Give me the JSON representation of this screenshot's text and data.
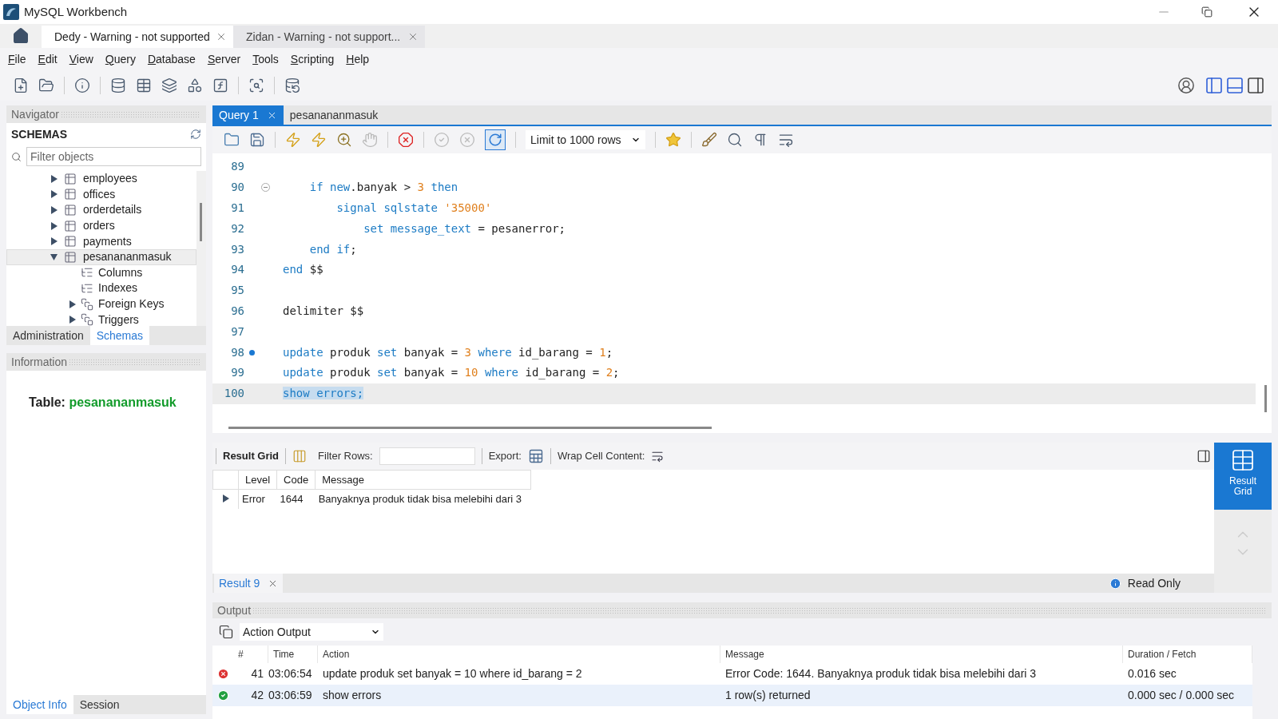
{
  "window": {
    "title": "MySQL Workbench"
  },
  "connection_tabs": [
    {
      "label": "Dedy - Warning - not supported",
      "selected": true
    },
    {
      "label": "Zidan - Warning - not support...",
      "selected": false
    }
  ],
  "menu": [
    "File",
    "Edit",
    "View",
    "Query",
    "Database",
    "Server",
    "Tools",
    "Scripting",
    "Help"
  ],
  "navigator": {
    "title": "Navigator",
    "section": "SCHEMAS",
    "filter": {
      "placeholder": "Filter objects"
    },
    "tree": [
      {
        "label": "employees",
        "expanded": false,
        "selected": false
      },
      {
        "label": "offices",
        "expanded": false,
        "selected": false
      },
      {
        "label": "orderdetails",
        "expanded": false,
        "selected": false
      },
      {
        "label": "orders",
        "expanded": false,
        "selected": false
      },
      {
        "label": "payments",
        "expanded": false,
        "selected": false
      },
      {
        "label": "pesanananmasuk",
        "expanded": true,
        "selected": true,
        "children": [
          {
            "label": "Columns",
            "kind": "leaf"
          },
          {
            "label": "Indexes",
            "kind": "leaf"
          },
          {
            "label": "Foreign Keys",
            "kind": "group",
            "expanded": false
          },
          {
            "label": "Triggers",
            "kind": "group",
            "expanded": false
          }
        ]
      }
    ],
    "tabs": [
      {
        "label": "Administration",
        "selected": false
      },
      {
        "label": "Schemas",
        "selected": true
      }
    ]
  },
  "information": {
    "title": "Information",
    "label": "Table:",
    "value": "pesanananmasuk",
    "tabs": [
      {
        "label": "Object Info",
        "selected": true
      },
      {
        "label": "Session",
        "selected": false
      }
    ]
  },
  "query_tabs": [
    {
      "label": "Query 1",
      "selected": true
    },
    {
      "label": "pesanananmasuk",
      "selected": false
    }
  ],
  "limit": "Limit to 1000 rows",
  "editor": {
    "lines": [
      {
        "number": "89",
        "selected": false,
        "marker": false
      },
      {
        "number": "90",
        "selected": false,
        "marker": false,
        "expanded": true,
        "tokens": [
          {
            "text": "    if",
            "kind": "keyword"
          },
          {
            "text": " new",
            "kind": "keyword"
          },
          {
            "text": ".banyak > ",
            "kind": "plain"
          },
          {
            "text": "3",
            "kind": "number"
          },
          {
            "text": " then",
            "kind": "keyword"
          }
        ]
      },
      {
        "number": "91",
        "selected": false,
        "marker": false,
        "tokens": [
          {
            "text": "        signal sqlstate",
            "kind": "keyword"
          },
          {
            "text": " '35000'",
            "kind": "string"
          }
        ]
      },
      {
        "number": "92",
        "selected": false,
        "marker": false,
        "tokens": [
          {
            "text": "            set message_text",
            "kind": "keyword"
          },
          {
            "text": " = pesanerror;",
            "kind": "plain"
          }
        ]
      },
      {
        "number": "93",
        "selected": false,
        "marker": false,
        "tokens": [
          {
            "text": "    end if",
            "kind": "keyword"
          },
          {
            "text": ";",
            "kind": "plain"
          }
        ]
      },
      {
        "number": "94",
        "selected": false,
        "marker": false,
        "tokens": [
          {
            "text": "end",
            "kind": "keyword"
          },
          {
            "text": " $$",
            "kind": "plain"
          }
        ]
      },
      {
        "number": "95",
        "selected": false,
        "marker": false
      },
      {
        "number": "96",
        "selected": false,
        "marker": false,
        "tokens": [
          {
            "text": "delimiter $$",
            "kind": "plain"
          }
        ]
      },
      {
        "number": "97",
        "selected": false,
        "marker": false
      },
      {
        "number": "98",
        "selected": false,
        "marker": true,
        "tokens": [
          {
            "text": "update",
            "kind": "keyword"
          },
          {
            "text": " produk ",
            "kind": "plain"
          },
          {
            "text": "set",
            "kind": "keyword"
          },
          {
            "text": " banyak = ",
            "kind": "plain"
          },
          {
            "text": "3",
            "kind": "number"
          },
          {
            "text": " where",
            "kind": "keyword"
          },
          {
            "text": " id_barang = ",
            "kind": "plain"
          },
          {
            "text": "1",
            "kind": "number"
          },
          {
            "text": ";",
            "kind": "plain"
          }
        ]
      },
      {
        "number": "99",
        "selected": false,
        "marker": false,
        "tokens": [
          {
            "text": "update",
            "kind": "keyword"
          },
          {
            "text": " produk ",
            "kind": "plain"
          },
          {
            "text": "set",
            "kind": "keyword"
          },
          {
            "text": " banyak = ",
            "kind": "plain"
          },
          {
            "text": "10",
            "kind": "number"
          },
          {
            "text": " where",
            "kind": "keyword"
          },
          {
            "text": " id_barang = ",
            "kind": "plain"
          },
          {
            "text": "2",
            "kind": "number"
          },
          {
            "text": ";",
            "kind": "plain"
          }
        ]
      },
      {
        "number": "100",
        "selected": true,
        "marker": false,
        "tokens": [
          {
            "text": "show errors;",
            "kind": "keyword"
          }
        ]
      }
    ]
  },
  "result": {
    "title": "Result Grid",
    "filter_label": "Filter Rows:",
    "export_label": "Export:",
    "wrap_label": "Wrap Cell Content:",
    "columns": [
      "Level",
      "Code",
      "Message"
    ],
    "rows": [
      [
        "Error",
        "1644",
        "Banyaknya produk tidak bisa melebihi dari 3"
      ]
    ],
    "tabs": [
      {
        "label": "Result 9",
        "selected": true
      }
    ],
    "read_only": "Read Only",
    "side_button": "Result Grid"
  },
  "output": {
    "title": "Output",
    "mode": "Action Output",
    "columns": [
      "#",
      "Time",
      "Action",
      "Message",
      "Duration / Fetch"
    ],
    "rows": [
      {
        "kind": "error",
        "selected": false,
        "cells": [
          "41",
          "03:06:54",
          "update produk set banyak = 10 where id_barang = 2",
          "Error Code: 1644. Banyaknya produk tidak bisa melebihi dari 3",
          "0.016 sec"
        ]
      },
      {
        "kind": "success",
        "selected": true,
        "cells": [
          "42",
          "03:06:59",
          "show errors",
          "1 row(s) returned",
          "0.000 sec / 0.000 sec"
        ]
      }
    ]
  }
}
